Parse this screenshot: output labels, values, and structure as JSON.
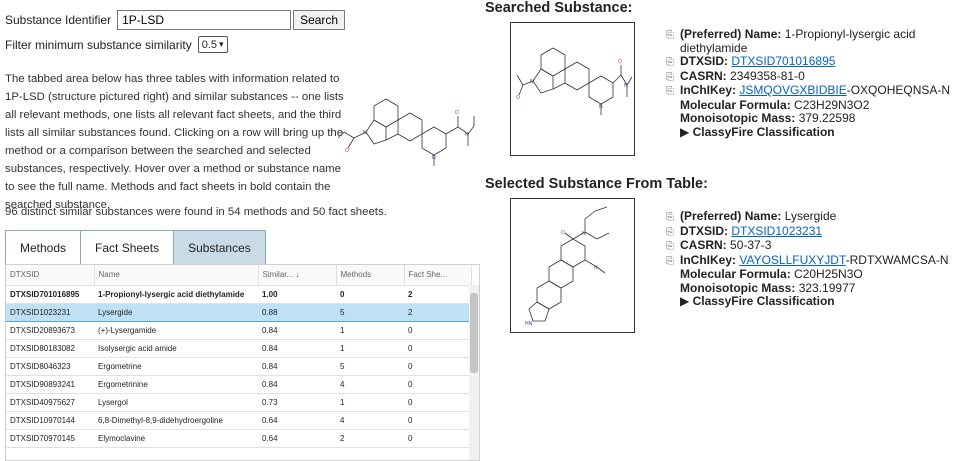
{
  "search": {
    "label": "Substance Identifier",
    "value": "1P-LSD",
    "button": "Search"
  },
  "filter": {
    "label": "Filter minimum substance similarity",
    "selected": "0.5"
  },
  "description": "The tabbed area below has three tables with information related to 1P-LSD (structure pictured right) and similar substances -- one lists all relevant methods, one lists all relevant fact sheets, and the third lists all similar substances found. Clicking on a row will bring up the method or a comparison between the searched and selected substances, respectively. Hover over a method or substance name to see the full name. Methods and fact sheets in bold contain the searched substance.",
  "count_text": "96 distinct similar substances were found in 54 methods and 50 fact sheets.",
  "tabs": [
    "Methods",
    "Fact Sheets",
    "Substances"
  ],
  "table": {
    "headers": [
      "DTXSID",
      "Name",
      "Similar... ↓",
      "Methods",
      "Fact She..."
    ],
    "rows": [
      [
        "DTXSID701016895",
        "1-Propionyl-lysergic acid diethylamide",
        "1.00",
        "0",
        "2"
      ],
      [
        "DTXSID1023231",
        "Lysergide",
        "0.88",
        "5",
        "2"
      ],
      [
        "DTXSID20893673",
        "(+)-Lysergamide",
        "0.84",
        "1",
        "0"
      ],
      [
        "DTXSID80183082",
        "Isolysergic acid amide",
        "0.84",
        "1",
        "0"
      ],
      [
        "DTXSID8046323",
        "Ergometrine",
        "0.84",
        "5",
        "0"
      ],
      [
        "DTXSID90893241",
        "Ergometrinine",
        "0.84",
        "4",
        "0"
      ],
      [
        "DTXSID40975627",
        "Lysergol",
        "0.73",
        "1",
        "0"
      ],
      [
        "DTXSID10970144",
        "6,8-Dimethyl-8,9-didehydroergoline",
        "0.64",
        "4",
        "0"
      ],
      [
        "DTXSID70970145",
        "Elymoclavine",
        "0.64",
        "2",
        "0"
      ]
    ]
  },
  "searched": {
    "heading": "Searched Substance:",
    "name_label": "(Preferred) Name:",
    "name": "1-Propionyl-lysergic acid diethylamide",
    "dtxsid_label": "DTXSID:",
    "dtxsid": "DTXSID701016895",
    "casrn_label": "CASRN:",
    "casrn": "2349358-81-0",
    "inchikey_label": "InChIKey:",
    "inchikey_link": "JSMQOVGXBIDBIE",
    "inchikey_rest": "-OXQOHEQNSA-N",
    "formula_label": "Molecular Formula:",
    "formula": "C23H29N3O2",
    "mass_label": "Monoisotopic Mass:",
    "mass": "379.22598",
    "classyfire": "▶ ClassyFire Classification"
  },
  "selected": {
    "heading": "Selected Substance From Table:",
    "name_label": "(Preferred) Name:",
    "name": "Lysergide",
    "dtxsid_label": "DTXSID:",
    "dtxsid": "DTXSID1023231",
    "casrn_label": "CASRN:",
    "casrn": "50-37-3",
    "inchikey_label": "InChIKey:",
    "inchikey_link": "VAYOSLLFUXYJDT",
    "inchikey_rest": "-RDTXWAMCSA-N",
    "formula_label": "Molecular Formula:",
    "formula": "C20H25N3O",
    "mass_label": "Monoisotopic Mass:",
    "mass": "323.19977",
    "classyfire": "▶ ClassyFire Classification"
  },
  "colors": {
    "tab_active": "#c8dbe6",
    "row_selected": "#bfe1f5",
    "link": "#0563c1"
  }
}
